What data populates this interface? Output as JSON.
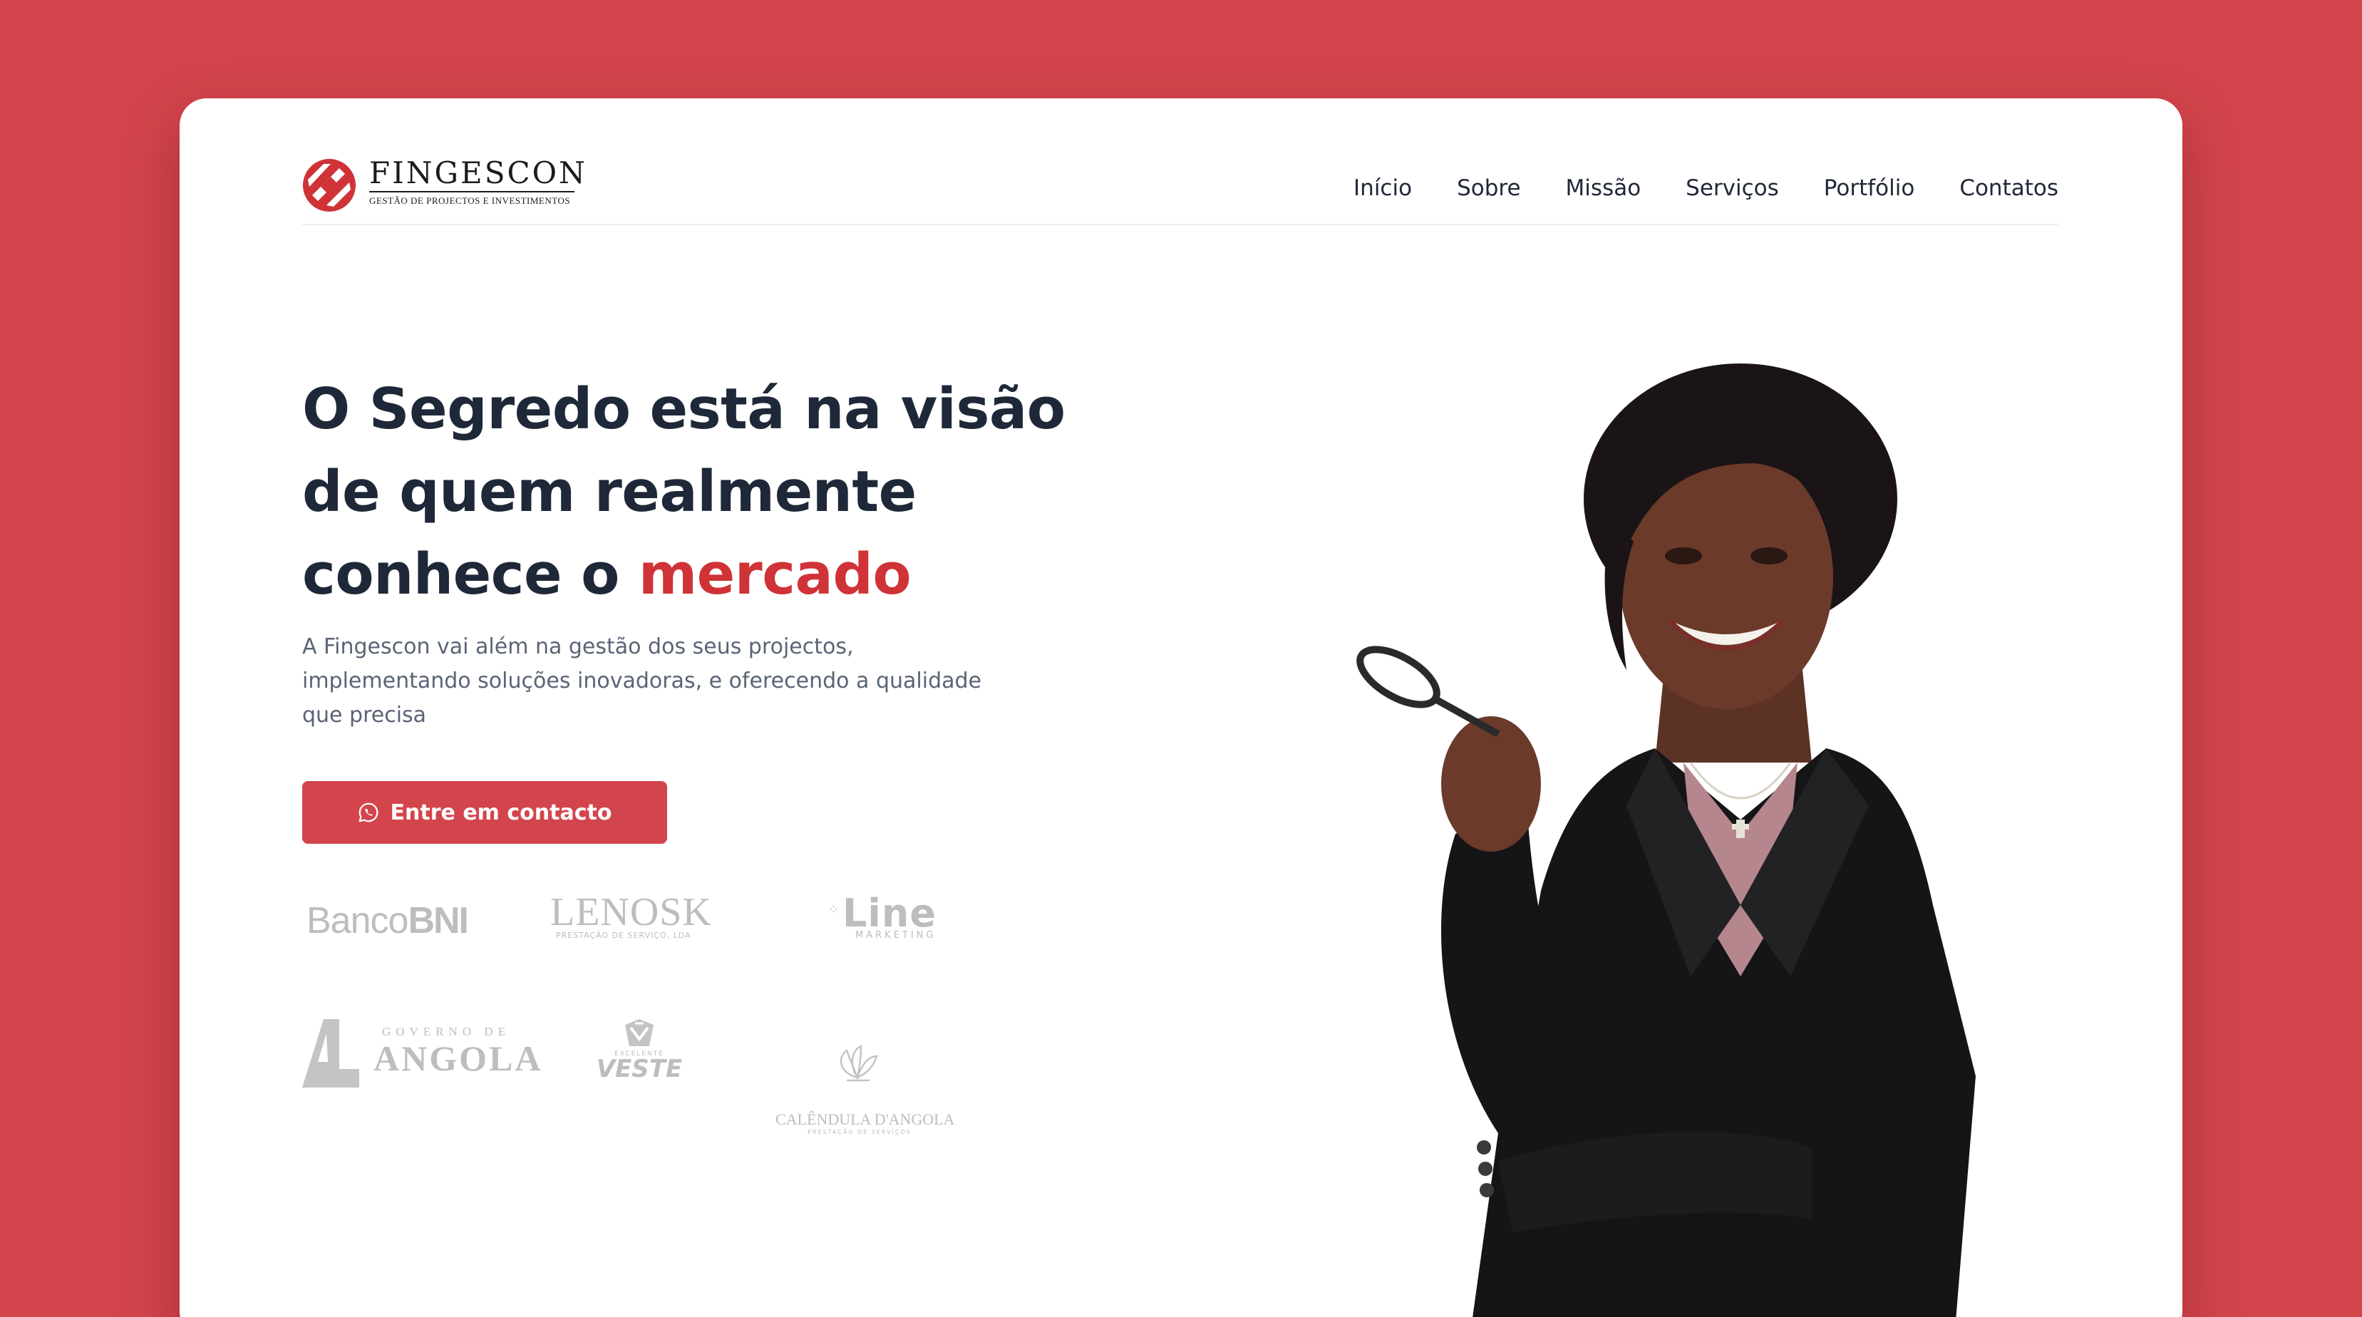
{
  "brand": {
    "name": "FINGESCON",
    "tagline": "GESTÃO DE PROJECTOS E INVESTIMENTOS",
    "accent_color": "#cf3337",
    "background_color": "#d3454c"
  },
  "nav": {
    "items": [
      "Início",
      "Sobre",
      "Missão",
      "Serviços",
      "Portfólio",
      "Contatos"
    ]
  },
  "hero": {
    "title_line1": "O Segredo está na visão",
    "title_line2": "de quem realmente",
    "title_line3_prefix": "conhece o ",
    "title_accent": "mercado",
    "description": "A Fingescon vai além na gestão dos seus projectos, implementando soluções inovadoras, e oferecendo a qualidade que precisa",
    "cta_label": "Entre em contacto",
    "cta_icon": "whatsapp-icon"
  },
  "partners": {
    "bni_light": "Banco",
    "bni_bold": "BNI",
    "lenosk_name": "LENOSK",
    "lenosk_sub": "PRESTAÇÃO DE SERVIÇO, LDA",
    "line_name": "Line",
    "line_sub": "MARKETING",
    "angola_small": "GOVERNO DE",
    "angola_big": "ANGOLA",
    "veste_small": "EXCELENTE",
    "veste_big": "VESTE",
    "calendula_name": "CALÊNDULA D'ANGOLA",
    "calendula_sub": "PRESTAÇÃO DE SERVIÇOS"
  },
  "portrait_alt": "portrait-photo"
}
